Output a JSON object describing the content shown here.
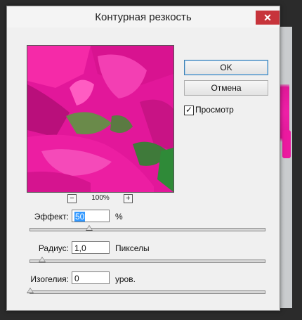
{
  "dialog": {
    "title": "Контурная резкость",
    "close_label": "✕"
  },
  "buttons": {
    "ok_label": "OK",
    "cancel_label": "Отмена"
  },
  "preview": {
    "checkbox_label": "Просмотр",
    "checked": true,
    "check_mark": "✓",
    "zoom_out_label": "−",
    "zoom_in_label": "+",
    "zoom_level": "100%"
  },
  "params": {
    "effect": {
      "label": "Эффект:",
      "value": "50",
      "unit": "%",
      "slider_fraction": 0.25
    },
    "radius": {
      "label": "Радиус:",
      "value": "1,0",
      "unit": "Пикселы",
      "slider_fraction": 0.05
    },
    "threshold": {
      "label": "Изогелия:",
      "value": "0",
      "unit": "уров.",
      "slider_fraction": 0.0
    }
  },
  "colors": {
    "accent_pink": "#e8189c",
    "close_button": "#c7343b",
    "selection": "#3399ff"
  }
}
